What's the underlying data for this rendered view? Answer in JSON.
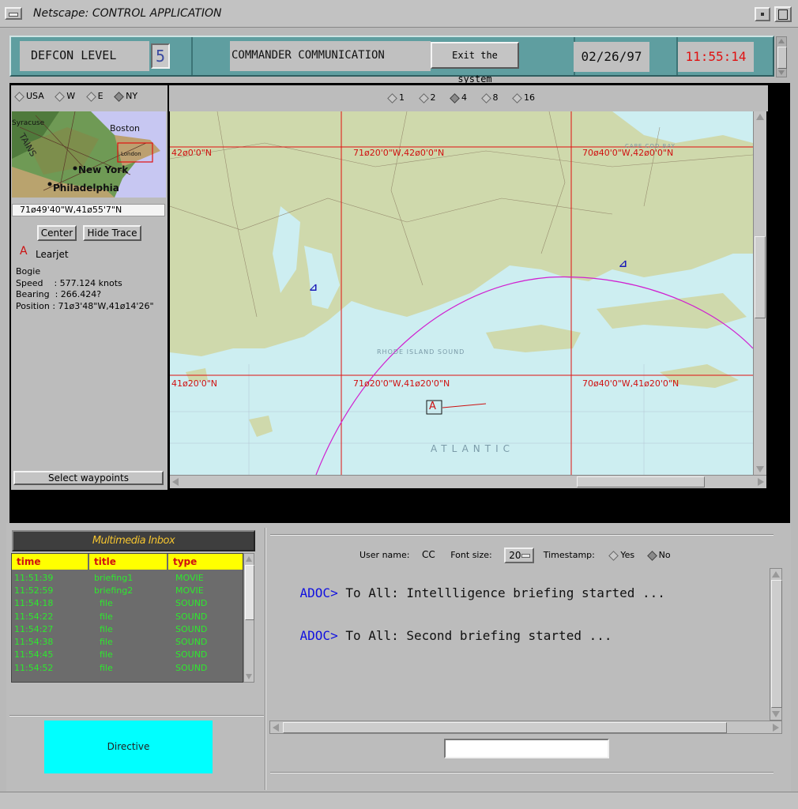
{
  "window": {
    "title": "Netscape: CONTROL APPLICATION"
  },
  "header": {
    "defcon_label": "DEFCON LEVEL",
    "defcon_value": "5",
    "comm_label": "COMMANDER COMMUNICATION",
    "exit_label": "Exit the system",
    "date": "02/26/97",
    "time": "11:55:14"
  },
  "region_options": [
    "USA",
    "W",
    "E",
    "NY"
  ],
  "region_selected": "NY",
  "zoom_options": [
    "1",
    "2",
    "4",
    "8",
    "16"
  ],
  "zoom_selected": "4",
  "overview": {
    "labels": {
      "syracuse": "Syracuse",
      "boston": "Boston",
      "new_york": "New York",
      "philadelphia": "Philadelphia",
      "london": "London",
      "mtns": "TAINS"
    },
    "coord": "71ø49'40\"W,41ø55'7\"N"
  },
  "controls": {
    "center_label": "Center",
    "hide_trace_label": "Hide Trace",
    "select_waypoints_label": "Select waypoints"
  },
  "track": {
    "icon_char": "A",
    "name": "Learjet",
    "bogie_label": "Bogie",
    "speed": "Speed    : 577.124 knots",
    "bearing": "Bearing  : 266.424?",
    "position": "Position : 71ø3'48\"W,41ø14'26\""
  },
  "map": {
    "grid_labels": {
      "g1": "42ø0'0\"N",
      "g2": "71ø20'0\"W,42ø0'0\"N",
      "g3": "70ø40'0\"W,42ø0'0\"N",
      "g4": "41ø20'0\"N",
      "g5": "71ø20'0\"W,41ø20'0\"N",
      "g6": "70ø40'0\"W,41ø20'0\"N"
    },
    "place_labels": {
      "cape_cod": "CAPE COD BAY",
      "atlantic": "ATLANTIC",
      "rhode_island": "RHODE ISLAND SOUND"
    },
    "colors": {
      "land": "#cfd9ac",
      "water": "#cdeef1",
      "grid": "#e01010",
      "arc": "#d020d0",
      "track": "#cc1010",
      "waypoint": "#1a1ab8"
    }
  },
  "inbox": {
    "title": "Multimedia Inbox",
    "columns": [
      "time",
      "title",
      "type"
    ],
    "rows": [
      [
        "11:51:39",
        "briefing1",
        "MOVIE"
      ],
      [
        "11:52:59",
        "briefing2",
        "MOVIE"
      ],
      [
        "11:54:18",
        "file",
        "SOUND"
      ],
      [
        "11:54:22",
        "file",
        "SOUND"
      ],
      [
        "11:54:27",
        "file",
        "SOUND"
      ],
      [
        "11:54:38",
        "file",
        "SOUND"
      ],
      [
        "11:54:45",
        "file",
        "SOUND"
      ],
      [
        "11:54:52",
        "file",
        "SOUND"
      ]
    ]
  },
  "directive_label": "Directive",
  "chat": {
    "username_label": "User name:",
    "username_value": "CC",
    "font_size_label": "Font size:",
    "font_size_value": "20",
    "timestamp_label": "Timestamp:",
    "timestamp_yes": "Yes",
    "timestamp_no": "No",
    "timestamp_selected": "No",
    "messages": [
      {
        "prefix": "ADOC>",
        "text": " To All: Intellligence briefing started ..."
      },
      {
        "prefix": "ADOC>",
        "text": " To All: Second briefing started ..."
      }
    ],
    "input_value": ""
  }
}
